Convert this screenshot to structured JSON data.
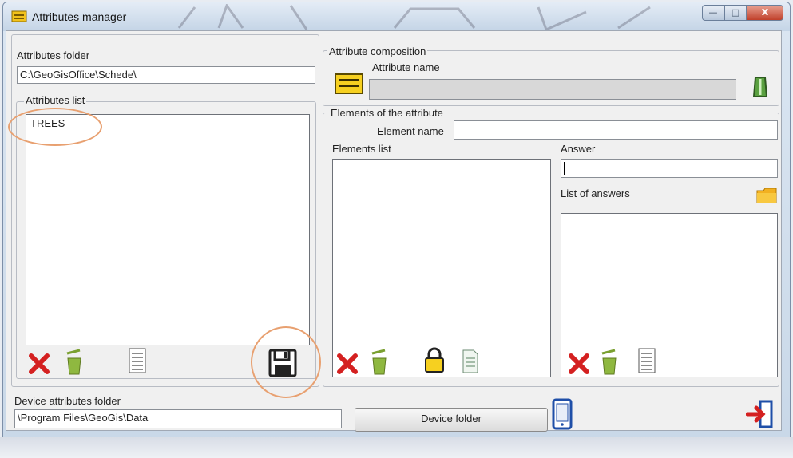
{
  "window": {
    "title": "Attributes manager",
    "controls": {
      "minimize": "—",
      "maximize": "□",
      "close": "X"
    }
  },
  "left": {
    "attributes_folder_label": "Attributes folder",
    "attributes_folder_value": "C:\\GeoGisOffice\\Schede\\",
    "attributes_list_label": "Attributes list",
    "attributes_list_items": [
      "TREES"
    ]
  },
  "right": {
    "composition_label": "Attribute composition",
    "attribute_name_label": "Attribute name",
    "attribute_name_value": "",
    "elements_group_label": "Elements of the attribute",
    "element_name_label": "Element name",
    "element_name_value": "",
    "elements_list_label": "Elements list",
    "answer_label": "Answer",
    "answer_value": "",
    "list_of_answers_label": "List of answers"
  },
  "bottom": {
    "device_folder_label": "Device attributes folder",
    "device_folder_value": "\\Program Files\\GeoGis\\Data",
    "device_folder_button": "Device folder"
  },
  "icons": {
    "title": "folder-icon",
    "attribute": "yellow-document-icon",
    "edit": "green-pen-icon",
    "delete": "red-x-icon",
    "clear": "green-bin-icon",
    "list": "list-icon",
    "save": "floppy-disk-icon",
    "lock": "lock-icon",
    "document": "document-icon",
    "folder": "folder-icon",
    "device": "mobile-device-icon",
    "exit": "exit-icon"
  },
  "colors": {
    "delete": "#d42020",
    "clear": "#7aa030",
    "highlight": "#e8a070",
    "accent": "#1f4fa8"
  }
}
